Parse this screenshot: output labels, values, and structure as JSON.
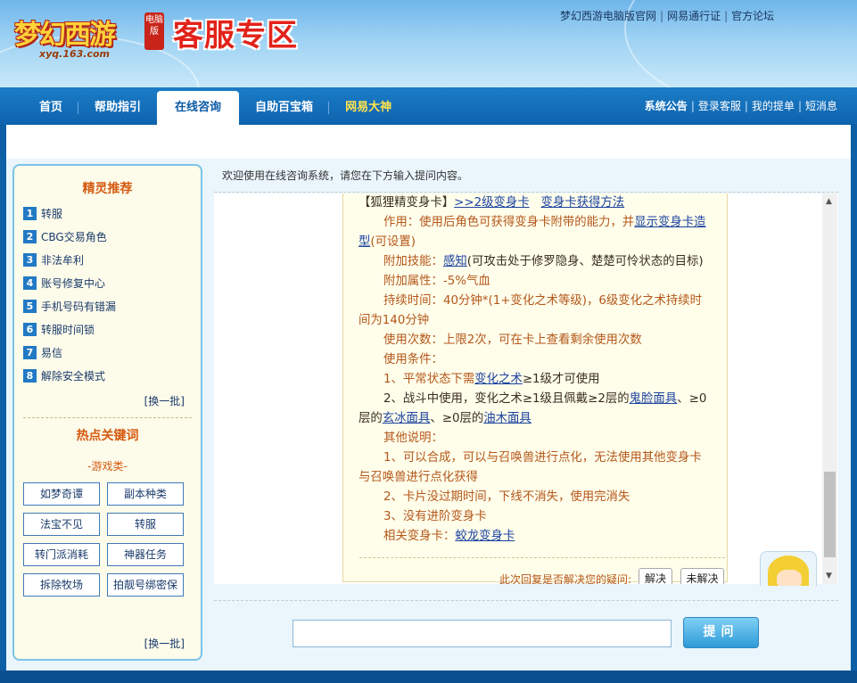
{
  "header": {
    "logo_text": "梦幻西游",
    "logo_badge": "电脑版",
    "logo_url": "xyq.163.com",
    "zone_title": "客服专区",
    "top_links": [
      "梦幻西游电脑版官网",
      "网易通行证",
      "官方论坛"
    ]
  },
  "nav": {
    "tabs": [
      "首页",
      "帮助指引",
      "在线咨询",
      "自助百宝箱",
      "网易大神"
    ],
    "active_tab": "在线咨询",
    "right_links": [
      "系统公告",
      "登录客服",
      "我的提单",
      "短消息"
    ]
  },
  "sidebar": {
    "recommend_title": "精灵推荐",
    "items": [
      {
        "num": "1",
        "label": "转服"
      },
      {
        "num": "2",
        "label": "CBG交易角色"
      },
      {
        "num": "3",
        "label": "非法牟利"
      },
      {
        "num": "4",
        "label": "账号修复中心"
      },
      {
        "num": "5",
        "label": "手机号码有错漏"
      },
      {
        "num": "6",
        "label": "转服时间锁"
      },
      {
        "num": "7",
        "label": "易信"
      },
      {
        "num": "8",
        "label": "解除安全模式"
      }
    ],
    "refresh_label": "[换一批]",
    "hot_title": "热点关键词",
    "hot_category": "-游戏类-",
    "keywords": [
      "如梦奇谭",
      "副本种类",
      "法宝不见",
      "转服",
      "转门派消耗",
      "神器任务",
      "拆除牧场",
      "拍靓号绑密保"
    ],
    "refresh_label2": "[换一批]"
  },
  "chat": {
    "welcome": "欢迎使用在线咨询系统，请您在下方输入提问内容。",
    "lines": {
      "l1_prefix": "【狐狸精变身卡】",
      "l1_link1": ">>2级变身卡",
      "l1_link2": "变身卡获得方法",
      "l2a": "作用：使用后角色可获得变身卡附带的能力，并",
      "l2_link": "显示变身卡造",
      "l3_link": "型",
      "l3b": "(可设置)",
      "l4a": "附加技能：",
      "l4_link": "感知",
      "l4b": "(可攻击处于修罗隐身、楚楚可怜状态的目标)",
      "l5": "附加属性：-5%气血",
      "l6": "持续时间：40分钟*(1+变化之术等级)，6级变化之术持续时",
      "l7": "间为140分钟",
      "l8": "使用次数：上限2次，可在卡上查看剩余使用次数",
      "l9": "使用条件：",
      "l10a": "1、平常状态下需",
      "l10_link": "变化之术",
      "l10b": "≥1级才可使用",
      "l11a": "2、战斗中使用，变化之术≥1级且佩戴≥2层的",
      "l11_link": "鬼脸面具",
      "l11b": "、≥0",
      "l12a": "层的",
      "l12_link1": "玄冰面具",
      "l12b": "、≥0层的",
      "l12_link2": "油木面具",
      "l13": "其他说明：",
      "l14": "1、可以合成，可以与召唤兽进行点化，无法使用其他变身卡",
      "l15": "与召唤兽进行点化获得",
      "l16": "2、卡片没过期时间，下线不消失，使用完消失",
      "l17": "3、没有进阶变身卡",
      "l18a": "相关变身卡：",
      "l18_link": "蛟龙变身卡"
    },
    "resolve_question": "此次回复是否解决您的疑问:",
    "resolved_label": "解决",
    "unresolved_label": "未解决",
    "input_value": "",
    "submit_label": "提问"
  }
}
